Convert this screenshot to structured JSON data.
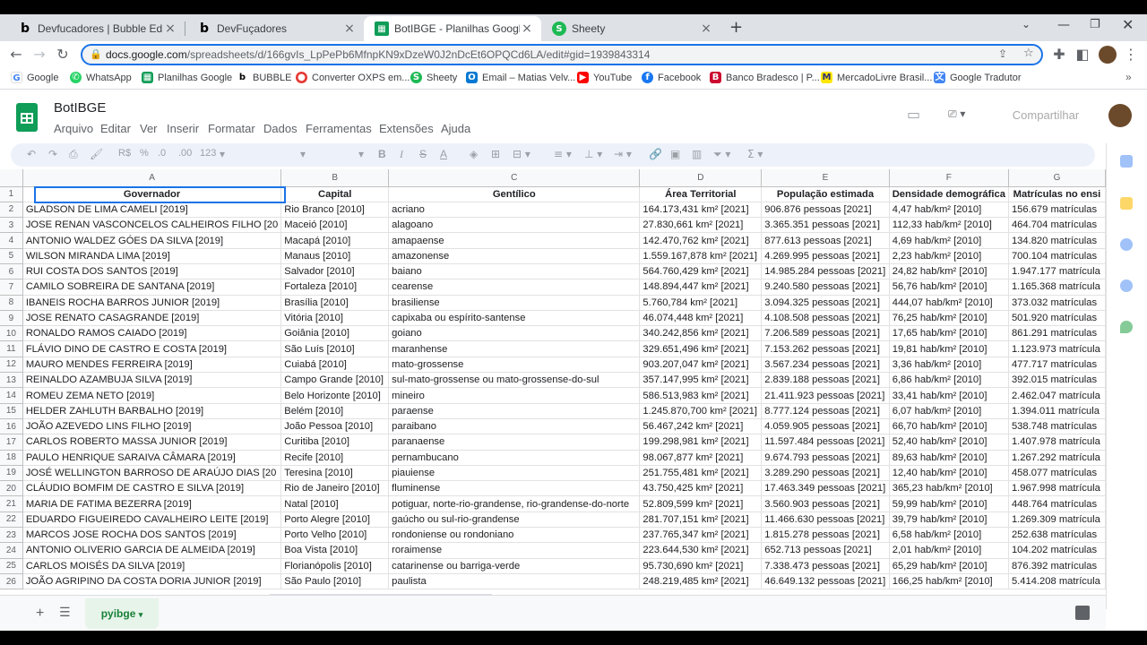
{
  "browser": {
    "tabs": [
      {
        "title": "Devfucadores | Bubble Editor",
        "icon": "bubble-icon"
      },
      {
        "title": "DevFuçadores",
        "icon": "bubble-icon"
      },
      {
        "title": "BotIBGE - Planilhas Google",
        "icon": "sheets-icon"
      },
      {
        "title": "Sheety",
        "icon": "sheety-icon"
      }
    ],
    "new_tab": "+",
    "url_host": "docs.google.com",
    "url_path": "/spreadsheets/d/166gvIs_LpPePb6MfnpKN9xDzeW0J2nDcEt6OPQCd6LA/edit#gid=1939843314",
    "bookmarks": [
      "Google",
      "WhatsApp",
      "Planilhas Google",
      "BUBBLE",
      "Converter OXPS em...",
      "Sheety",
      "Email – Matias Velv...",
      "YouTube",
      "Facebook",
      "Banco Bradesco | P...",
      "MercadoLivre Brasil...",
      "Google Tradutor"
    ]
  },
  "sheets": {
    "title": "BotIBGE",
    "menus": [
      "Arquivo",
      "Editar",
      "Ver",
      "Inserir",
      "Formatar",
      "Dados",
      "Ferramentas",
      "Extensões",
      "Ajuda"
    ],
    "share_label": "Compartilhar",
    "toolbar": {
      "currency": "R$",
      "percent": "%",
      "dec_down": ".0",
      "dec_up": ".00",
      "format_123": "123"
    },
    "sheet_tab": "pyibge"
  },
  "grid": {
    "column_letters": [
      "A",
      "B",
      "C",
      "D",
      "E",
      "F",
      "G"
    ],
    "headers": [
      "Governador",
      "Capital",
      "Gentílico",
      "Área Territorial",
      "População estimada",
      "Densidade demográfica",
      "Matrículas no ensi"
    ],
    "rows": [
      [
        "GLADSON DE LIMA CAMELI   [2019]",
        "Rio Branco   [2010]",
        "acriano",
        "164.173,431 km²   [2021]",
        "906.876 pessoas   [2021]",
        "4,47 hab/km²   [2010]",
        "156.679 matrículas"
      ],
      [
        "JOSE RENAN VASCONCELOS CALHEIROS FILHO   [20",
        "Maceió   [2010]",
        "alagoano",
        "27.830,661 km²   [2021]",
        "3.365.351 pessoas   [2021]",
        "112,33 hab/km²   [2010]",
        "464.704 matrículas"
      ],
      [
        "ANTONIO WALDEZ GÓES DA SILVA   [2019]",
        "Macapá   [2010]",
        "amapaense",
        "142.470,762 km²   [2021]",
        "877.613 pessoas   [2021]",
        "4,69 hab/km²   [2010]",
        "134.820 matrículas"
      ],
      [
        "WILSON MIRANDA LIMA   [2019]",
        "Manaus   [2010]",
        "amazonense",
        "1.559.167,878 km²   [2021]",
        "4.269.995 pessoas   [2021]",
        "2,23 hab/km²   [2010]",
        "700.104 matrículas"
      ],
      [
        "RUI COSTA DOS SANTOS   [2019]",
        "Salvador   [2010]",
        "baiano",
        "564.760,429 km²   [2021]",
        "14.985.284 pessoas   [2021]",
        "24,82 hab/km²   [2010]",
        "1.947.177 matrícula"
      ],
      [
        "CAMILO SOBREIRA DE SANTANA   [2019]",
        "Fortaleza   [2010]",
        "cearense",
        "148.894,447 km²   [2021]",
        "9.240.580 pessoas   [2021]",
        "56,76 hab/km²   [2010]",
        "1.165.368 matrícula"
      ],
      [
        "IBANEIS ROCHA BARROS JUNIOR   [2019]",
        "Brasília   [2010]",
        "brasiliense",
        "5.760,784 km²   [2021]",
        "3.094.325 pessoas   [2021]",
        "444,07 hab/km²   [2010]",
        "373.032 matrículas"
      ],
      [
        "JOSE RENATO CASAGRANDE   [2019]",
        "Vitória   [2010]",
        "capixaba ou espírito-santense",
        "46.074,448 km²   [2021]",
        "4.108.508 pessoas   [2021]",
        "76,25 hab/km²   [2010]",
        "501.920 matrículas"
      ],
      [
        "RONALDO RAMOS CAIADO   [2019]",
        "Goiânia   [2010]",
        "goiano",
        "340.242,856 km²   [2021]",
        "7.206.589 pessoas   [2021]",
        "17,65 hab/km²   [2010]",
        "861.291 matrículas"
      ],
      [
        "FLÁVIO DINO DE CASTRO E COSTA   [2019]",
        "São Luís   [2010]",
        "maranhense",
        "329.651,496 km²   [2021]",
        "7.153.262 pessoas   [2021]",
        "19,81 hab/km²   [2010]",
        "1.123.973 matrícula"
      ],
      [
        "MAURO MENDES FERREIRA   [2019]",
        "Cuiabá   [2010]",
        "mato-grossense",
        "903.207,047 km²   [2021]",
        "3.567.234 pessoas   [2021]",
        "3,36 hab/km²   [2010]",
        "477.717 matrículas"
      ],
      [
        "REINALDO AZAMBUJA SILVA   [2019]",
        "Campo Grande   [2010]",
        "sul-mato-grossense ou mato-grossense-do-sul",
        "357.147,995 km²   [2021]",
        "2.839.188 pessoas   [2021]",
        "6,86 hab/km²   [2010]",
        "392.015 matrículas"
      ],
      [
        "ROMEU ZEMA NETO   [2019]",
        "Belo Horizonte   [2010]",
        "mineiro",
        "586.513,983 km²   [2021]",
        "21.411.923 pessoas   [2021]",
        "33,41 hab/km²   [2010]",
        "2.462.047 matrícula"
      ],
      [
        "HELDER ZAHLUTH BARBALHO   [2019]",
        "Belém   [2010]",
        "paraense",
        "1.245.870,700 km²   [2021]",
        "8.777.124 pessoas   [2021]",
        "6,07 hab/km²   [2010]",
        "1.394.011 matrícula"
      ],
      [
        "JOÃO AZEVEDO LINS FILHO   [2019]",
        "João Pessoa   [2010]",
        "paraibano",
        "56.467,242 km²   [2021]",
        "4.059.905 pessoas   [2021]",
        "66,70 hab/km²   [2010]",
        "538.748 matrículas"
      ],
      [
        "CARLOS ROBERTO MASSA JUNIOR   [2019]",
        "Curitiba   [2010]",
        "paranaense",
        "199.298,981 km²   [2021]",
        "11.597.484 pessoas   [2021]",
        "52,40 hab/km²   [2010]",
        "1.407.978 matrícula"
      ],
      [
        "PAULO HENRIQUE SARAIVA CÂMARA   [2019]",
        "Recife   [2010]",
        "pernambucano",
        "98.067,877 km²   [2021]",
        "9.674.793 pessoas   [2021]",
        "89,63 hab/km²   [2010]",
        "1.267.292 matrícula"
      ],
      [
        "JOSÉ WELLINGTON BARROSO DE ARAÚJO DIAS   [20",
        "Teresina   [2010]",
        "piauiense",
        "251.755,481 km²   [2021]",
        "3.289.290 pessoas   [2021]",
        "12,40 hab/km²   [2010]",
        "458.077 matrículas"
      ],
      [
        "CLÁUDIO BOMFIM DE CASTRO E SILVA   [2019]",
        "Rio de Janeiro   [2010]",
        "fluminense",
        "43.750,425 km²   [2021]",
        "17.463.349 pessoas   [2021]",
        "365,23 hab/km²   [2010]",
        "1.967.998 matrícula"
      ],
      [
        "MARIA DE FATIMA BEZERRA   [2019]",
        "Natal   [2010]",
        "potiguar, norte-rio-grandense, rio-grandense-do-norte",
        "52.809,599 km²   [2021]",
        "3.560.903 pessoas   [2021]",
        "59,99 hab/km²   [2010]",
        "448.764 matrículas"
      ],
      [
        "EDUARDO FIGUEIREDO CAVALHEIRO LEITE   [2019]",
        "Porto Alegre   [2010]",
        "gaúcho ou sul-rio-grandense",
        "281.707,151 km²   [2021]",
        "11.466.630 pessoas   [2021]",
        "39,79 hab/km²   [2010]",
        "1.269.309 matrícula"
      ],
      [
        "MARCOS JOSE ROCHA DOS SANTOS   [2019]",
        "Porto Velho   [2010]",
        "rondoniense ou rondoniano",
        "237.765,347 km²   [2021]",
        "1.815.278 pessoas   [2021]",
        "6,58 hab/km²   [2010]",
        "252.638 matrículas"
      ],
      [
        "ANTONIO OLIVERIO GARCIA DE ALMEIDA   [2019]",
        "Boa Vista   [2010]",
        "roraimense",
        "223.644,530 km²   [2021]",
        "652.713 pessoas   [2021]",
        "2,01 hab/km²   [2010]",
        "104.202 matrículas"
      ],
      [
        "CARLOS MOISÉS DA SILVA   [2019]",
        "Florianópolis   [2010]",
        "catarinense ou barriga-verde",
        "95.730,690 km²   [2021]",
        "7.338.473 pessoas   [2021]",
        "65,29 hab/km²   [2010]",
        "876.392 matrículas"
      ],
      [
        "JOÃO AGRIPINO DA COSTA DORIA JUNIOR   [2019]",
        "São Paulo   [2010]",
        "paulista",
        "248.219,485 km²   [2021]",
        "46.649.132 pessoas   [2021]",
        "166,25 hab/km²   [2010]",
        "5.414.208 matrícula"
      ]
    ]
  }
}
